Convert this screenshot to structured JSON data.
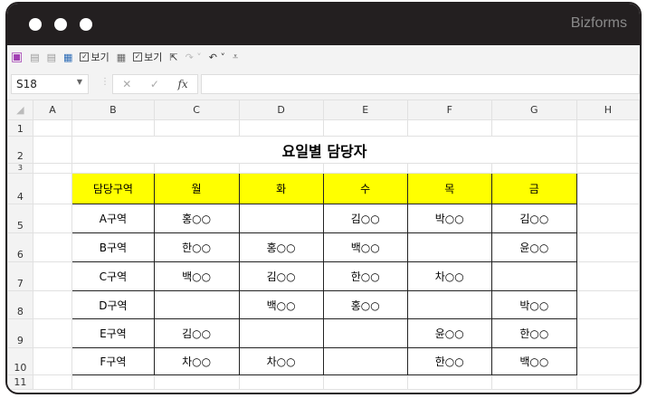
{
  "window": {
    "brand": "Bizforms"
  },
  "toolbar": {
    "view_label_1": "보기",
    "view_label_2": "보기"
  },
  "formula_bar": {
    "name_box": "S18",
    "cancel": "✕",
    "enter": "✓",
    "fx": "fx",
    "formula": ""
  },
  "columns": [
    "A",
    "B",
    "C",
    "D",
    "E",
    "F",
    "G",
    "H"
  ],
  "rows": [
    "1",
    "2",
    "3",
    "4",
    "5",
    "6",
    "7",
    "8",
    "9",
    "10",
    "11"
  ],
  "sheet": {
    "title": "요일별 담당자",
    "header": [
      "담당구역",
      "월",
      "화",
      "수",
      "목",
      "금"
    ],
    "data": [
      [
        "A구역",
        "홍○○",
        "",
        "김○○",
        "박○○",
        "김○○"
      ],
      [
        "B구역",
        "한○○",
        "홍○○",
        "백○○",
        "",
        "윤○○"
      ],
      [
        "C구역",
        "백○○",
        "김○○",
        "한○○",
        "차○○",
        ""
      ],
      [
        "D구역",
        "",
        "백○○",
        "홍○○",
        "",
        "박○○"
      ],
      [
        "E구역",
        "김○○",
        "",
        "",
        "윤○○",
        "한○○"
      ],
      [
        "F구역",
        "차○○",
        "차○○",
        "",
        "한○○",
        "백○○"
      ]
    ]
  },
  "colors": {
    "header_fill": "#ffff00",
    "titlebar": "#231f20"
  }
}
